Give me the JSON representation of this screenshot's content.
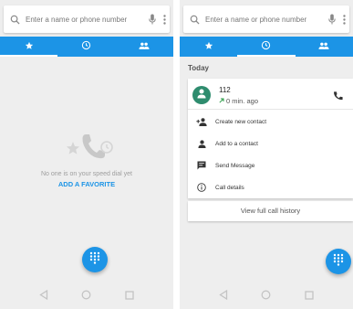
{
  "left_screen": {
    "search": {
      "placeholder": "Enter a name or phone number"
    },
    "tabs": [
      {
        "icon": "star-icon",
        "active": true
      },
      {
        "icon": "clock-icon",
        "active": false
      },
      {
        "icon": "people-icon",
        "active": false
      }
    ],
    "empty_state": {
      "message": "No one is on your speed dial yet",
      "action_label": "ADD A FAVORITE"
    }
  },
  "right_screen": {
    "search": {
      "placeholder": "Enter a name or phone number"
    },
    "tabs": [
      {
        "icon": "star-icon",
        "active": false
      },
      {
        "icon": "clock-icon",
        "active": true
      },
      {
        "icon": "people-icon",
        "active": false
      }
    ],
    "section_header": "Today",
    "call_entry": {
      "number": "112",
      "time": "0 min. ago",
      "direction": "outgoing"
    },
    "actions": [
      {
        "icon": "add-contact-icon",
        "label": "Create new contact"
      },
      {
        "icon": "person-icon",
        "label": "Add to a contact"
      },
      {
        "icon": "message-icon",
        "label": "Send Message"
      },
      {
        "icon": "info-icon",
        "label": "Call details"
      }
    ],
    "history_link": "View full call history"
  },
  "colors": {
    "accent": "#1c94e6",
    "avatar": "#2e8c6e",
    "outgoing_arrow": "#2e9e4a"
  }
}
